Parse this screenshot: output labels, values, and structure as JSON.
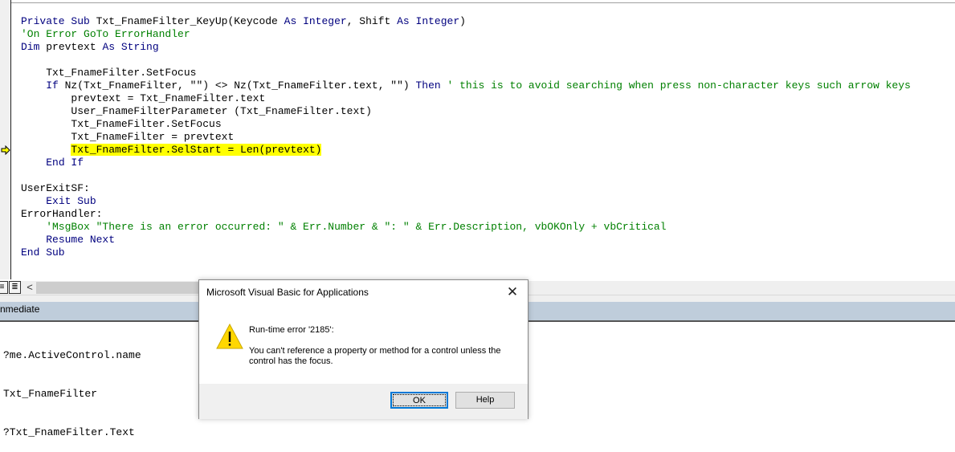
{
  "code_lines": [
    [
      {
        "t": "Private Sub ",
        "c": "kw"
      },
      {
        "t": "Txt_FnameFilter_KeyUp(Keycode ",
        "c": "tx"
      },
      {
        "t": "As Integer",
        "c": "kw"
      },
      {
        "t": ", Shift ",
        "c": "tx"
      },
      {
        "t": "As Integer",
        "c": "kw"
      },
      {
        "t": ")",
        "c": "tx"
      }
    ],
    [
      {
        "t": "'On Error GoTo ErrorHandler",
        "c": "cm"
      }
    ],
    [
      {
        "t": "Dim ",
        "c": "kw"
      },
      {
        "t": "prevtext ",
        "c": "tx"
      },
      {
        "t": "As String",
        "c": "kw"
      }
    ],
    [],
    [
      {
        "t": "    Txt_FnameFilter.SetFocus",
        "c": "tx"
      }
    ],
    [
      {
        "t": "    ",
        "c": "tx"
      },
      {
        "t": "If ",
        "c": "kw"
      },
      {
        "t": "Nz(Txt_FnameFilter, \"\") <> Nz(Txt_FnameFilter.text, \"\") ",
        "c": "tx"
      },
      {
        "t": "Then ",
        "c": "kw"
      },
      {
        "t": "' this is to avoid searching when press non-character keys such arrow keys",
        "c": "cm"
      }
    ],
    [
      {
        "t": "        prevtext = Txt_FnameFilter.text",
        "c": "tx"
      }
    ],
    [
      {
        "t": "        User_FnameFilterParameter (Txt_FnameFilter.text)",
        "c": "tx"
      }
    ],
    [
      {
        "t": "        Txt_FnameFilter.SetFocus",
        "c": "tx"
      }
    ],
    [
      {
        "t": "        Txt_FnameFilter = prevtext",
        "c": "tx"
      }
    ],
    [
      {
        "t": "        ",
        "c": "tx"
      },
      {
        "t": "Txt_FnameFilter.SelStart = Len(prevtext)",
        "c": "hl"
      }
    ],
    [
      {
        "t": "    ",
        "c": "tx"
      },
      {
        "t": "End If",
        "c": "kw"
      }
    ],
    [],
    [
      {
        "t": "UserExitSF:",
        "c": "tx"
      }
    ],
    [
      {
        "t": "    ",
        "c": "tx"
      },
      {
        "t": "Exit Sub",
        "c": "kw"
      }
    ],
    [
      {
        "t": "ErrorHandler:",
        "c": "tx"
      }
    ],
    [
      {
        "t": "    'MsgBox \"There is an error occurred: \" & Err.Number & \": \" & Err.Description, vbOKOnly + vbCritical",
        "c": "cm"
      }
    ],
    [
      {
        "t": "    ",
        "c": "tx"
      },
      {
        "t": "Resume Next",
        "c": "kw"
      }
    ],
    [
      {
        "t": "End Sub",
        "c": "kw"
      }
    ]
  ],
  "immediate": {
    "title": "nmediate",
    "lines": [
      "?me.ActiveControl.name",
      "Txt_FnameFilter",
      "?Txt_FnameFilter.Text"
    ]
  },
  "scroll": {
    "left_arrow": "<"
  },
  "dialog": {
    "title": "Microsoft Visual Basic for Applications",
    "close": "✕",
    "error": "Run-time error '2185':",
    "message": "You can't reference a property or method for a control unless the control has the focus.",
    "ok": "OK",
    "help": "Help",
    "icon": "warning-icon"
  },
  "colors": {
    "keyword": "#00007f",
    "comment": "#008000",
    "highlight": "#ffff00",
    "accent": "#0078d7"
  }
}
